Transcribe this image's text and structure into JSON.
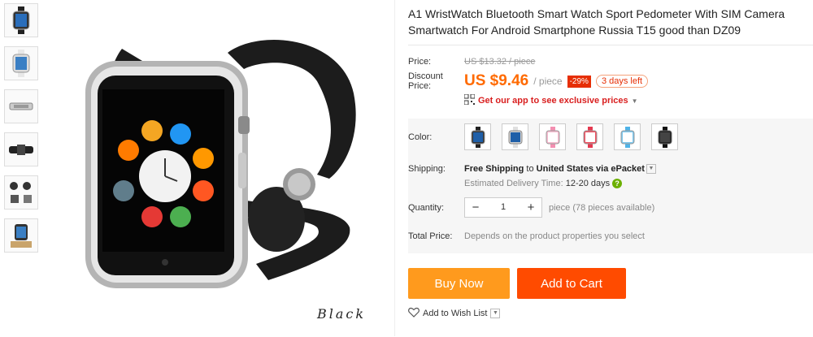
{
  "gallery": {
    "caption": "Black"
  },
  "product": {
    "title": "A1 WristWatch Bluetooth Smart Watch Sport Pedometer With SIM Camera Smartwatch For Android Smartphone Russia T15 good than DZ09"
  },
  "pricing": {
    "price_label": "Price:",
    "original_price": "US $13.32 / piece",
    "discount_label_line1": "Discount",
    "discount_label_line2": "Price:",
    "discount_price": "US $9.46",
    "per_unit": "/ piece",
    "discount_badge": "-29%",
    "days_left": "3 days left",
    "app_promo": "Get our app to see exclusive prices"
  },
  "options": {
    "color_label": "Color:",
    "colors": [
      "black",
      "silver",
      "pink",
      "red",
      "blue",
      "black-2"
    ],
    "shipping_label": "Shipping:",
    "shipping_free": "Free Shipping",
    "shipping_to": "to",
    "shipping_country": "United States",
    "shipping_via": "via ePacket",
    "delivery_label": "Estimated Delivery Time:",
    "delivery_time": "12-20 days",
    "quantity_label": "Quantity:",
    "quantity_value": "1",
    "quantity_available": "piece (78 pieces available)",
    "total_label": "Total Price:",
    "total_text": "Depends on the product properties you select"
  },
  "actions": {
    "buy_now": "Buy Now",
    "add_to_cart": "Add to Cart",
    "wishlist": "Add to Wish List"
  },
  "colors_hex": {
    "accent": "#ff6a00",
    "buy_button": "#ff9a1d",
    "cart_button": "#ff4b00",
    "promo_red": "#d91f1f"
  }
}
